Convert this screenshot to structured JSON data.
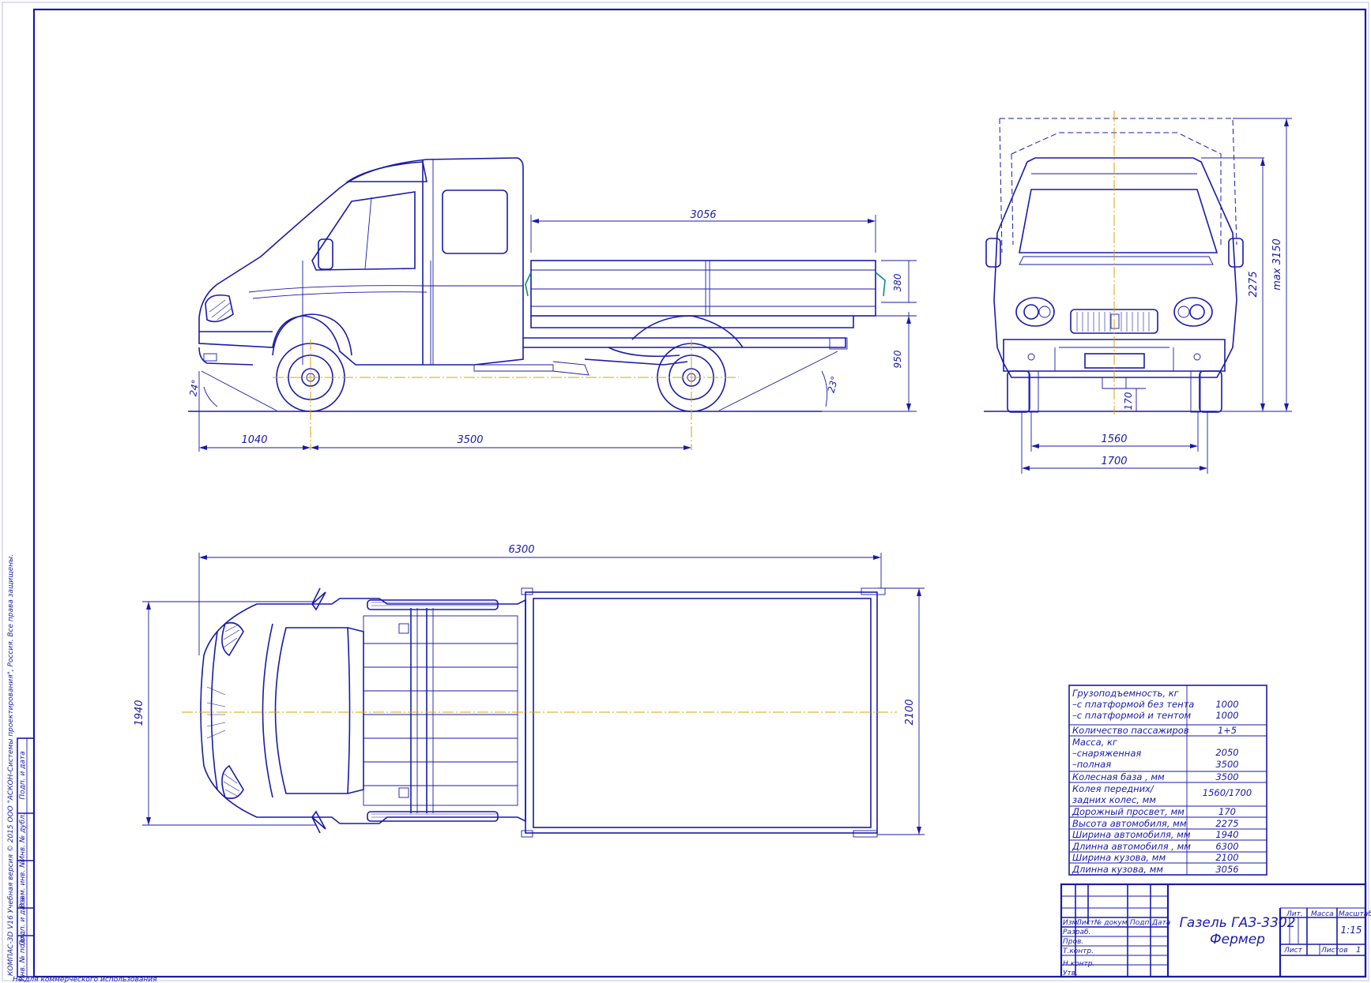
{
  "side_view": {
    "dim_platform_length": "3056",
    "dim_side_height": "380",
    "dim_floor_height": "950",
    "dim_front_overhang": "1040",
    "dim_wheelbase": "3500",
    "angle_front": "24°",
    "angle_rear": "23°"
  },
  "front_view": {
    "dim_max_height": "max 3150",
    "dim_height": "2275",
    "dim_clearance": "170",
    "dim_track_front": "1560",
    "dim_track_rear": "1700"
  },
  "top_view": {
    "dim_total_length": "6300",
    "dim_width": "1940",
    "dim_body_width": "2100"
  },
  "specs": {
    "rows": [
      {
        "label": "Грузоподъемность, кг",
        "value": ""
      },
      {
        "label": "–с платформой без тента",
        "value": "1000"
      },
      {
        "label": "–с платформой и тентом",
        "value": "1000"
      },
      {
        "label": "Количество пассажиров",
        "value": "1+5"
      },
      {
        "label": "Масса, кг",
        "value": ""
      },
      {
        "label": "–снаряженная",
        "value": "2050"
      },
      {
        "label": "–полная",
        "value": "3500"
      },
      {
        "label": "Колесная база , мм",
        "value": "3500"
      },
      {
        "label": "Колея передних/",
        "value": ""
      },
      {
        "label": "задних колес, мм",
        "value": "1560/1700"
      },
      {
        "label": "Дорожный просвет, мм",
        "value": "170"
      },
      {
        "label": "Высота автомобиля, мм",
        "value": "2275"
      },
      {
        "label": "Ширина автомобиля, мм",
        "value": "1940"
      },
      {
        "label": "Длинна автомобиля , мм",
        "value": "6300"
      },
      {
        "label": "Ширина кузова, мм",
        "value": "2100"
      },
      {
        "label": "Длинна кузова, мм",
        "value": "3056"
      }
    ]
  },
  "title_block": {
    "title_line1": "Газель ГАЗ-3302",
    "title_line2": "Фермер",
    "col_izm": "Изм.",
    "col_list": "Лист",
    "col_doc": "№ докум.",
    "col_sign": "Подп.",
    "col_date": "Дата",
    "row_razrab": "Разраб.",
    "row_prov": "Пров.",
    "row_tkontr": "Т.контр.",
    "row_nkontr": "Н.контр.",
    "row_utv": "Утв.",
    "lit": "Лит.",
    "massa": "Масса",
    "masshtab": "Масштаб",
    "scale_value": "1:15",
    "list": "Лист",
    "listov": "Листов",
    "listov_value": "1"
  },
  "margin": {
    "copyright": "КОМПАС-3D V16 Учебная версия  © 2015 ООО \"АСКОН-Системы проектирования\", Россия. Все права защищены.",
    "not_commercial": "Не для коммерческого использования",
    "cell_inv_podl": "Инв. № подл.",
    "cell_podp_data1": "Подп. и дата",
    "cell_vzam": "Взам. инв. №",
    "cell_inv_dubl": "Инв. № дубл.",
    "cell_podp_data2": "Подп. и дата"
  }
}
